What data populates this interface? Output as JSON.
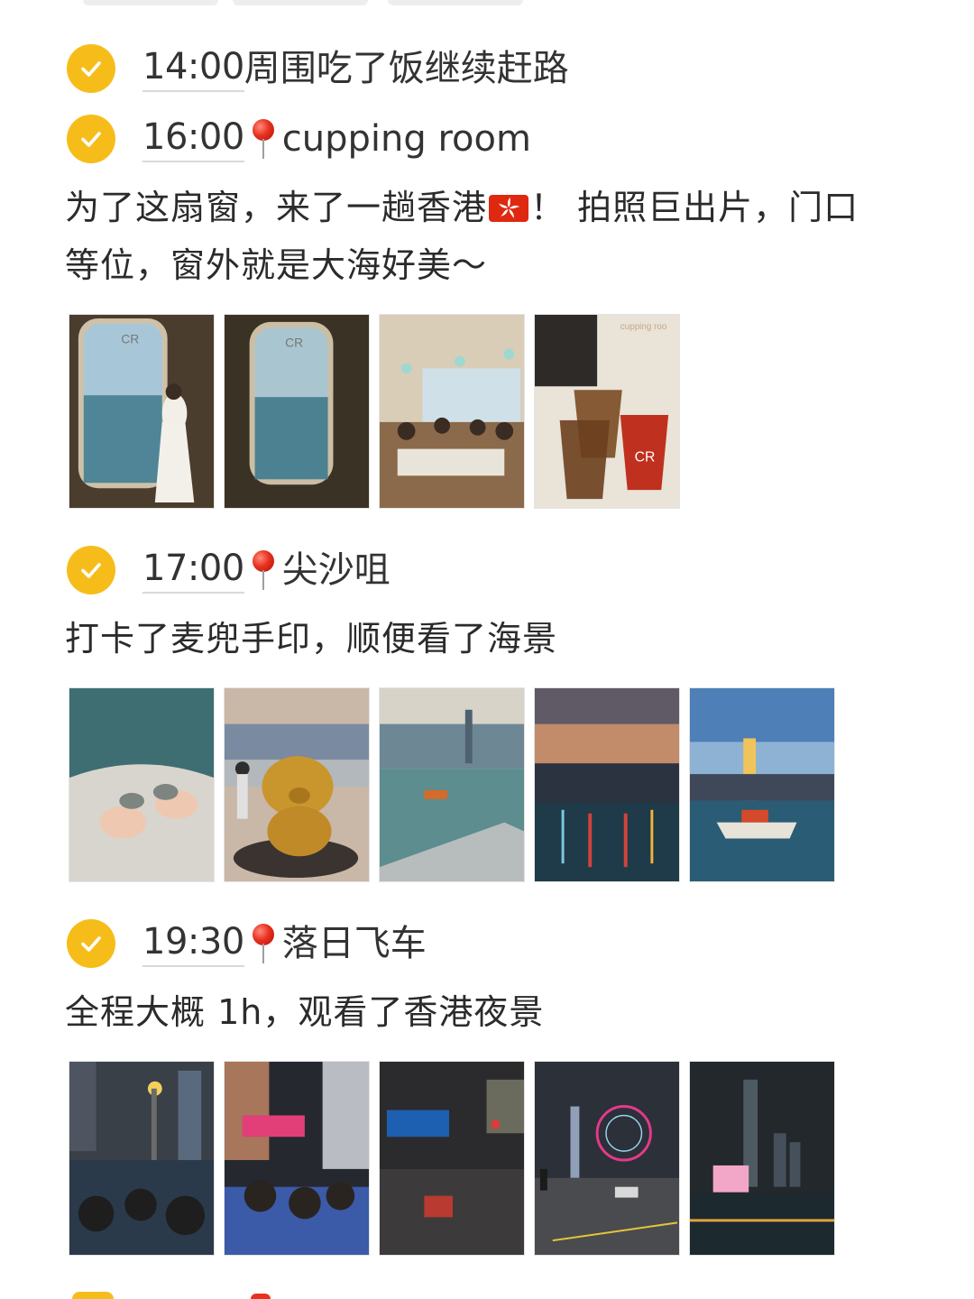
{
  "entries": [
    {
      "time": "14:00",
      "title": "周围吃了饭继续赶路"
    },
    {
      "time": "16:00",
      "title": "cupping room",
      "text_line1": "为了这扇窗，来了一趟香港",
      "text_line1_end": "！ 拍照巨出片，门口",
      "text_line2": "等位，窗外就是大海好美～"
    },
    {
      "time": "17:00",
      "title": "尖沙咀",
      "text_line1": "打卡了麦兜手印，顺便看了海景"
    },
    {
      "time": "19:30",
      "title": "落日飞车",
      "text_line1": "全程大概 1h，观看了香港夜景"
    }
  ],
  "icons": {
    "check": "check-circle-icon",
    "pin": "round-pushpin-icon",
    "flag": "hong-kong-flag-icon"
  },
  "colors": {
    "check_bg": "#f6bd1a",
    "pin_red": "#e8311f",
    "flag_red": "#de2910",
    "text": "#2b2b2b"
  },
  "photos": {
    "cupping_room": [
      "window-woman-photo",
      "window-sea-photo",
      "cafe-interior-photo",
      "iced-coffee-photo"
    ],
    "tsim_sha_tsui": [
      "handprint-photo",
      "mcdull-statue-photo",
      "harbour-ferry-photo",
      "harbour-sunset-photo",
      "boat-skyline-photo"
    ],
    "night_bus": [
      "bus-tower-photo",
      "bus-street-photo",
      "traffic-sign-photo",
      "ferris-wheel-photo",
      "night-harbour-photo"
    ]
  },
  "photo_labels": {
    "cr_logo": "CR",
    "cupping_sign": "cupping roo"
  }
}
